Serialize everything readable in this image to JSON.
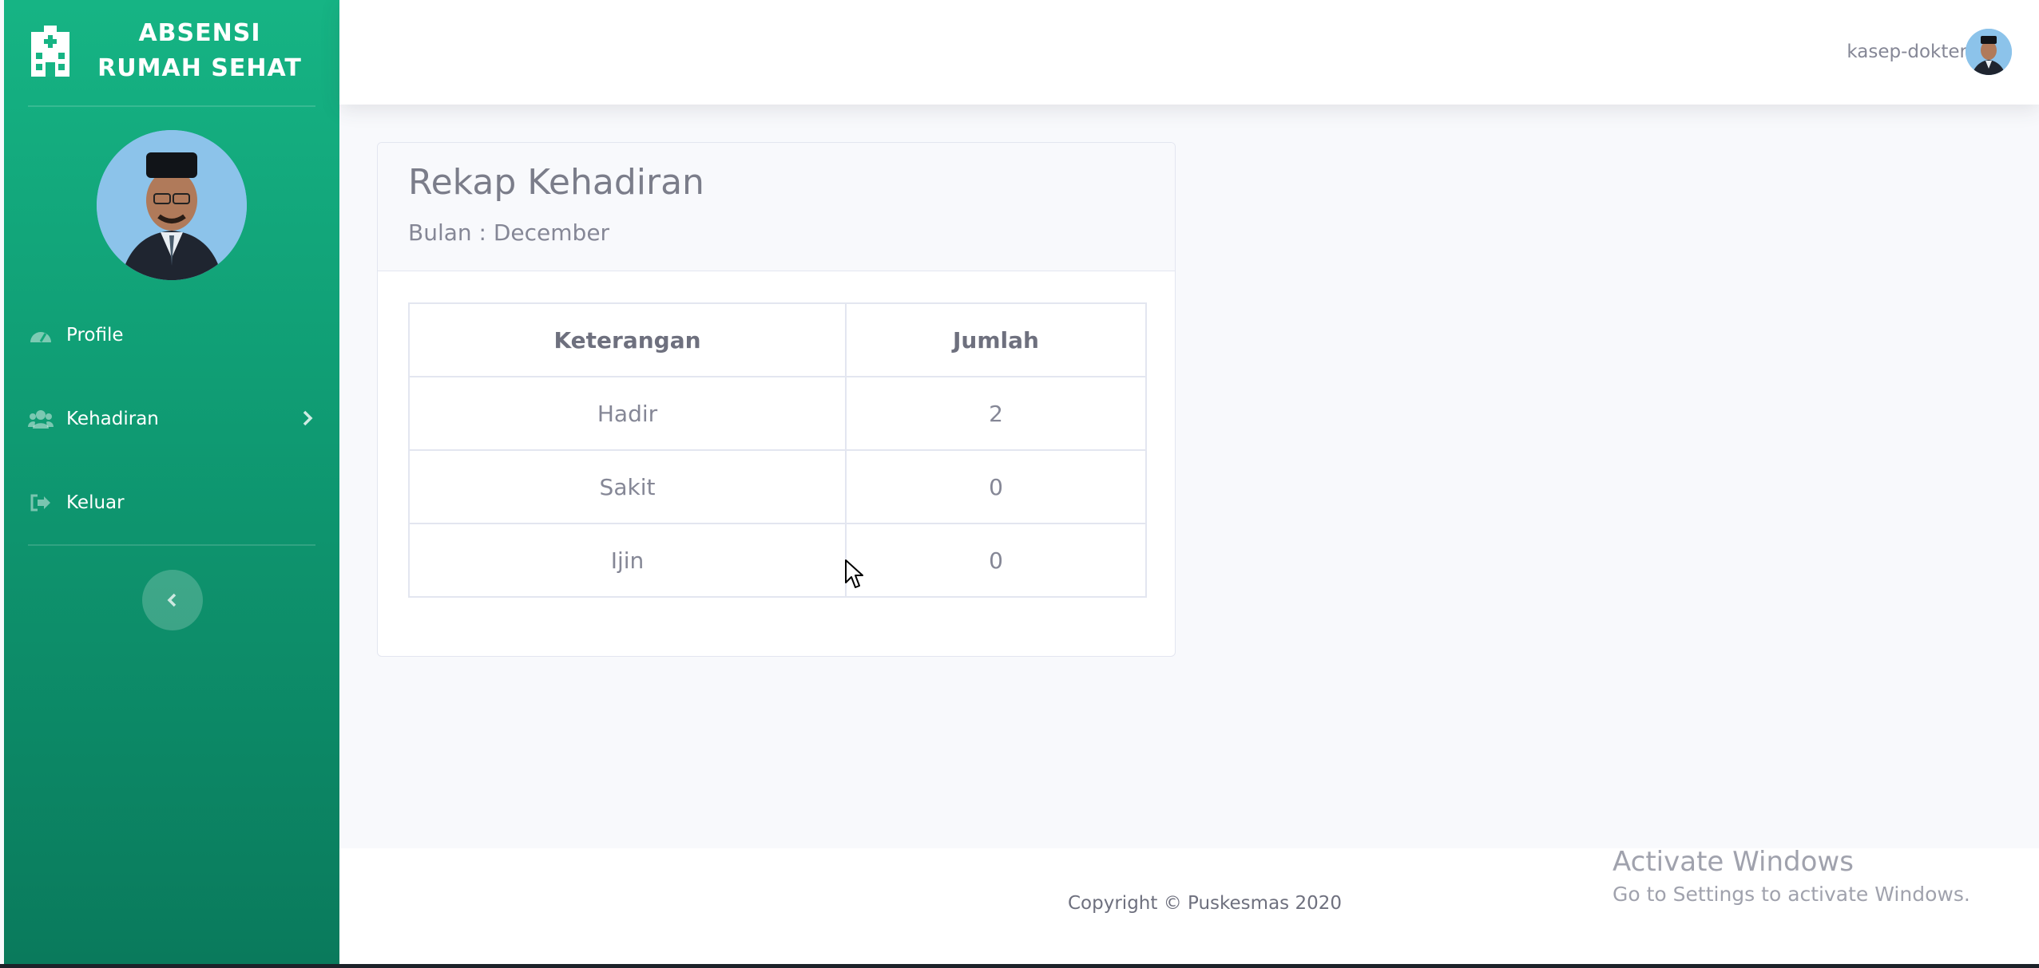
{
  "brand": {
    "line1": "ABSENSI",
    "line2": "RUMAH SEHAT",
    "icon": "hospital-icon"
  },
  "sidebar": {
    "items": [
      {
        "label": "Profile",
        "icon": "tachometer-icon"
      },
      {
        "label": "Kehadiran",
        "icon": "users-icon",
        "has_chevron": true
      },
      {
        "label": "Keluar",
        "icon": "sign-out-icon"
      }
    ],
    "toggle_icon": "chevron-left-icon"
  },
  "topbar": {
    "username": "kasep-dokter"
  },
  "card": {
    "title": "Rekap Kehadiran",
    "subtitle": "Bulan : December",
    "table": {
      "headers": [
        "Keterangan",
        "Jumlah"
      ],
      "rows": [
        [
          "Hadir",
          "2"
        ],
        [
          "Sakit",
          "0"
        ],
        [
          "Ijin",
          "0"
        ]
      ]
    }
  },
  "footer": {
    "copyright": "Copyright © Puskesmas 2020"
  },
  "watermark": {
    "line1": "Activate Windows",
    "line2": "Go to Settings to activate Windows."
  },
  "colors": {
    "sidebar_top": "#16b484",
    "sidebar_bottom": "#0a7a5c",
    "background": "#f8f9fc"
  }
}
